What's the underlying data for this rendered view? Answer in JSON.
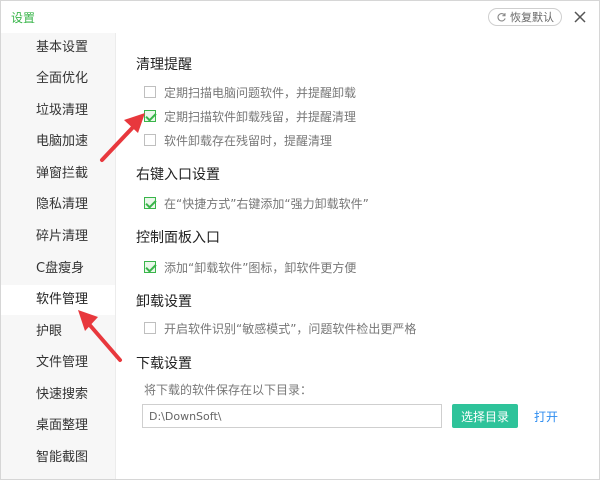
{
  "titlebar": {
    "title": "设置",
    "restore_label": "恢复默认"
  },
  "sidebar": {
    "items": [
      {
        "label": "基本设置"
      },
      {
        "label": "全面优化"
      },
      {
        "label": "垃圾清理"
      },
      {
        "label": "电脑加速"
      },
      {
        "label": "弹窗拦截"
      },
      {
        "label": "隐私清理"
      },
      {
        "label": "碎片清理"
      },
      {
        "label": "C盘瘦身"
      },
      {
        "label": "软件管理",
        "active": true
      },
      {
        "label": "护眼"
      },
      {
        "label": "文件管理"
      },
      {
        "label": "快速搜索"
      },
      {
        "label": "桌面整理"
      },
      {
        "label": "智能截图"
      }
    ]
  },
  "sections": [
    {
      "title": "清理提醒",
      "options": [
        {
          "label": "定期扫描电脑问题软件，并提醒卸载",
          "checked": false
        },
        {
          "label": "定期扫描软件卸载残留，并提醒清理",
          "checked": true
        },
        {
          "label": "软件卸载存在残留时，提醒清理",
          "checked": false
        }
      ]
    },
    {
      "title": "右键入口设置",
      "options": [
        {
          "label": "在“快捷方式”右键添加“强力卸载软件”",
          "checked": true
        }
      ]
    },
    {
      "title": "控制面板入口",
      "options": [
        {
          "label": "添加“卸载软件”图标，卸软件更方便",
          "checked": true
        }
      ]
    },
    {
      "title": "卸载设置",
      "options": [
        {
          "label": "开启软件识别“敏感模式”，问题软件检出更严格",
          "checked": false
        }
      ]
    },
    {
      "title": "下载设置",
      "options": []
    }
  ],
  "download": {
    "path_label": "将下载的软件保存在以下目录：",
    "path_value": "D:\\DownSoft\\",
    "choose_label": "选择目录",
    "open_label": "打开"
  },
  "colors": {
    "accent": "#39b54a",
    "button": "#2ec39a",
    "link": "#2d8cf0",
    "annotation_arrow": "#e8383d"
  }
}
